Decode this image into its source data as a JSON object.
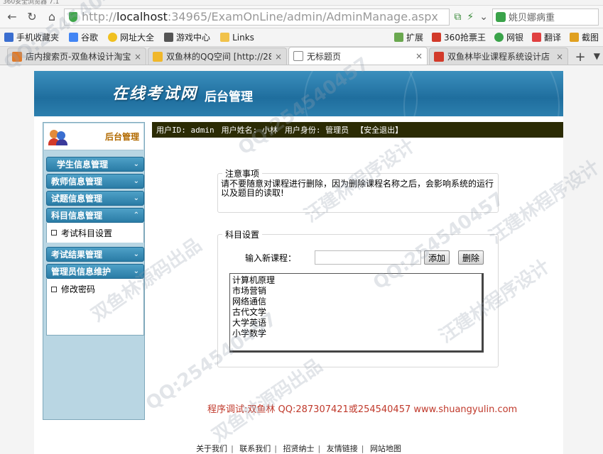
{
  "browser": {
    "top_strip": "360安全浏览器 7.1",
    "url_prefix": "http://",
    "url_host": "localhost",
    "url_rest": ":34965/ExamOnLine/admin/AdminManage.aspx",
    "search_text": "姚贝娜病重",
    "bookmarks": [
      "手机收藏夹",
      "谷歌",
      "网址大全",
      "游戏中心",
      "Links"
    ],
    "bookmarks_right": [
      "扩展",
      "360抢票王",
      "网银",
      "翻译",
      "截图"
    ],
    "tabs": [
      {
        "label": "店内搜索页-双鱼林设计淘宝",
        "color": "#e07b2a"
      },
      {
        "label": "双鱼林的QQ空间 [http://28",
        "color": "#f0b72a"
      },
      {
        "label": "无标题页",
        "color": "#ffffff"
      },
      {
        "label": "双鱼林毕业课程系统设计店",
        "color": "#d23a2a"
      }
    ]
  },
  "site": {
    "banner_title": "在线考试网",
    "banner_sub": "后台管理",
    "sidebar_head": "后台管理",
    "menu": {
      "student": "学生信息管理",
      "teacher": "教师信息管理",
      "question": "试题信息管理",
      "subject": "科目信息管理",
      "subject_item": "考试科目设置",
      "result": "考试结果管理",
      "admin": "管理员信息维护",
      "admin_item": "修改密码"
    },
    "userbar": {
      "id": "用户ID: admin",
      "name": "用户姓名: 小林",
      "role": "用户身份: 管理员",
      "logout": "【安全退出】"
    },
    "notice": {
      "legend": "注意事项",
      "text": "请不要随意对课程进行删除，因为删除课程名称之后，会影响系统的运行以及题目的读取!"
    },
    "course": {
      "legend": "科目设置",
      "input_label": "输入新课程：",
      "input_value": "",
      "add": "添加",
      "delete": "删除",
      "items": [
        "计算机原理",
        "市场营销",
        "网络通信",
        "古代文学",
        "大学英语",
        "小学数学"
      ]
    },
    "credit": "程序调试:双鱼林 QQ:287307421或254540457 www.shuangyulin.com",
    "footer": [
      "关于我们",
      "联系我们",
      "招贤纳士",
      "友情链接",
      "网站地图"
    ]
  },
  "watermarks": [
    "QQ:254540457",
    "双鱼林源码出品",
    "汪建林程序设计",
    "QQ:254540457",
    "汪建林程序设计",
    "双鱼林源码出品",
    "QQ:254540457",
    "汪建林程序设计",
    "QQ:254540457"
  ]
}
